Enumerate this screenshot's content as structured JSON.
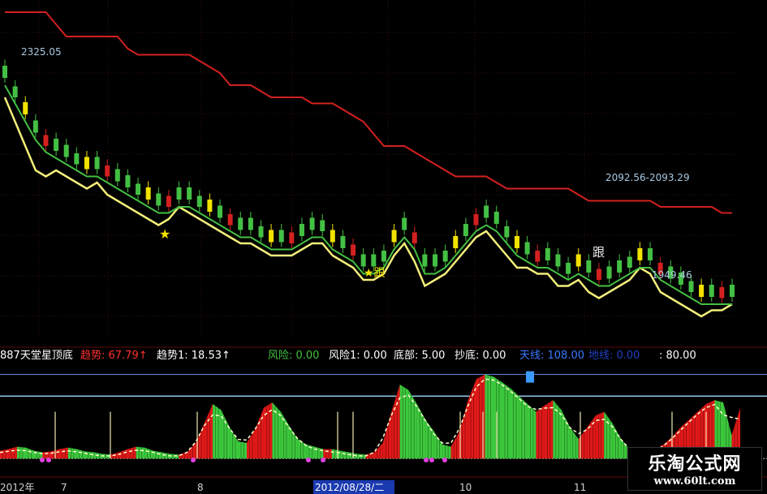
{
  "chart_data": [
    {
      "type": "candlestick",
      "panel": "main",
      "price_labels": {
        "high": "2325.05",
        "range": "2092.56-2093.29",
        "low": "1949.46"
      },
      "annotations": [
        "★",
        "★跟",
        "跟"
      ],
      "series": [
        {
          "name": "",
          "color": "#d42020",
          "values": [
            2420,
            2420,
            2420,
            2420,
            2420,
            2400,
            2380,
            2380,
            2380,
            2380,
            2380,
            2380,
            2360,
            2350,
            2350,
            2350,
            2350,
            2350,
            2350,
            2340,
            2330,
            2320,
            2300,
            2300,
            2300,
            2290,
            2280,
            2280,
            2280,
            2280,
            2270,
            2270,
            2270,
            2260,
            2250,
            2240,
            2220,
            2200,
            2200,
            2200,
            2190,
            2180,
            2170,
            2160,
            2150,
            2150,
            2150,
            2150,
            2140,
            2130,
            2130,
            2130,
            2130,
            2130,
            2130,
            2130,
            2120,
            2110,
            2110,
            2110,
            2110,
            2110,
            2110,
            2110,
            2100,
            2100,
            2100,
            2100,
            2100,
            2100,
            2090,
            2090
          ]
        },
        {
          "name": "",
          "color": "#f2ee7a",
          "values": [
            2280,
            2240,
            2200,
            2160,
            2150,
            2160,
            2150,
            2140,
            2130,
            2140,
            2120,
            2110,
            2100,
            2090,
            2080,
            2070,
            2080,
            2100,
            2090,
            2080,
            2070,
            2060,
            2050,
            2040,
            2040,
            2030,
            2020,
            2020,
            2020,
            2030,
            2040,
            2040,
            2020,
            2010,
            2000,
            1980,
            1980,
            1990,
            2020,
            2040,
            2010,
            1970,
            1980,
            1990,
            2010,
            2030,
            2050,
            2060,
            2040,
            2020,
            2000,
            2000,
            1990,
            1990,
            1970,
            1970,
            1980,
            1960,
            1950,
            1960,
            1970,
            1980,
            2000,
            1990,
            1960,
            1950,
            1940,
            1930,
            1920,
            1930,
            1930,
            1940
          ]
        },
        {
          "name": "",
          "color": "#43c043",
          "values": [
            2300,
            2270,
            2240,
            2210,
            2190,
            2180,
            2170,
            2160,
            2150,
            2150,
            2140,
            2130,
            2120,
            2110,
            2100,
            2090,
            2090,
            2100,
            2100,
            2090,
            2080,
            2070,
            2060,
            2050,
            2050,
            2040,
            2030,
            2030,
            2030,
            2040,
            2050,
            2050,
            2030,
            2020,
            2010,
            1990,
            1990,
            2000,
            2030,
            2050,
            2030,
            1990,
            1990,
            2000,
            2020,
            2040,
            2060,
            2070,
            2060,
            2040,
            2020,
            2010,
            2000,
            2000,
            1990,
            1980,
            1990,
            1980,
            1970,
            1970,
            1980,
            1990,
            2000,
            2000,
            1980,
            1970,
            1960,
            1950,
            1940,
            1940,
            1940,
            1940
          ]
        }
      ],
      "ylim": [
        1880,
        2440
      ]
    },
    {
      "type": "area",
      "panel": "indicator",
      "indicator_header": [
        {
          "text": "887天堂星顶底",
          "color": "#ffffff"
        },
        {
          "text": "趋势: 67.79↑",
          "color": "#ff3030"
        },
        {
          "text": "趋势1: 18.53↑",
          "color": "#ffffff"
        },
        {
          "text": "风险: 0.00",
          "color": "#43c043"
        },
        {
          "text": "风险1: 0.00",
          "color": "#ffffff"
        },
        {
          "text": "底部: 5.00",
          "color": "#ffffff"
        },
        {
          "text": "抄底: 0.00",
          "color": "#ffffff"
        },
        {
          "text": "天线: 108.00",
          "color": "#3a78ff"
        },
        {
          "text": "地线: 0.00",
          "color": "#2040c0"
        },
        {
          "text": ": 80.00",
          "color": "#ffffff"
        }
      ],
      "trend_values": [
        10,
        12,
        15,
        14,
        10,
        8,
        9,
        12,
        14,
        12,
        9,
        8,
        6,
        5,
        8,
        12,
        15,
        14,
        10,
        8,
        6,
        5,
        8,
        20,
        45,
        70,
        62,
        40,
        22,
        20,
        38,
        65,
        72,
        60,
        42,
        25,
        18,
        15,
        12,
        12,
        10,
        8,
        6,
        5,
        8,
        20,
        60,
        95,
        88,
        70,
        50,
        35,
        18,
        15,
        35,
        75,
        102,
        108,
        105,
        98,
        90,
        80,
        70,
        60,
        68,
        75,
        62,
        40,
        25,
        40,
        55,
        60,
        45,
        25,
        12,
        8,
        10,
        12,
        18,
        28,
        40,
        50,
        60,
        70,
        75,
        72,
        30,
        65
      ],
      "ylim": [
        -5,
        120
      ],
      "reference_lines": {
        "ceiling": 108,
        "upper": 80,
        "floor": 0
      }
    }
  ],
  "x_axis": {
    "labels": [
      "2012年",
      "7",
      "8",
      "2012/08/28/二",
      "10",
      "11"
    ],
    "highlight": "2012/08/28/二"
  },
  "watermark": {
    "title": "乐淘公式网",
    "url": "www.60lt.com"
  }
}
